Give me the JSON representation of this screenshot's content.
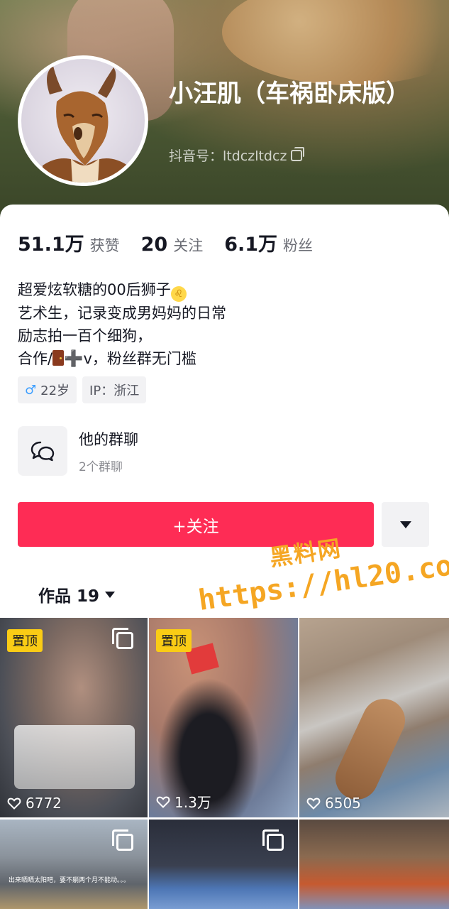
{
  "profile": {
    "nickname": "小汪肌（车祸卧床版）",
    "douyin_id": "抖音号：ltdczltdcz"
  },
  "stats": [
    {
      "num": "51.1万",
      "label": "获赞"
    },
    {
      "num": "20",
      "label": "关注"
    },
    {
      "num": "6.1万",
      "label": "粉丝"
    }
  ],
  "bio": {
    "line1": "超爱炫软糖的00后狮子",
    "line2": "艺术生，记录变成男妈妈的日常",
    "line3": "励志拍一百个细狗，",
    "line4_a": "合作/",
    "line4_b": "v，粉丝群无门槛"
  },
  "tags": {
    "gender_symbol": "♂",
    "age": "22岁",
    "ip": "IP：浙江"
  },
  "group_chat": {
    "title": "他的群聊",
    "subtitle": "2个群聊"
  },
  "actions": {
    "follow_label": "+关注"
  },
  "works_tab": {
    "label": "作品 19"
  },
  "watermark": {
    "line1": "黑料网",
    "line2": "https://hl20.co"
  },
  "videos": [
    {
      "pinned": "置顶",
      "likes": "6772",
      "multi": true
    },
    {
      "pinned": "置顶",
      "likes": "1.3万",
      "multi": false
    },
    {
      "pinned": "",
      "likes": "6505",
      "multi": false
    },
    {
      "pinned": "",
      "likes": "",
      "multi": true,
      "caption": "出来晒晒太阳吧，要不躺两个月不能动。。。"
    },
    {
      "pinned": "",
      "likes": "",
      "multi": true
    },
    {
      "pinned": "",
      "likes": "",
      "multi": false
    }
  ],
  "colors": {
    "follow_button": "#fe2c55",
    "pin_badge": "#facc15",
    "watermark": "#f5a623"
  }
}
